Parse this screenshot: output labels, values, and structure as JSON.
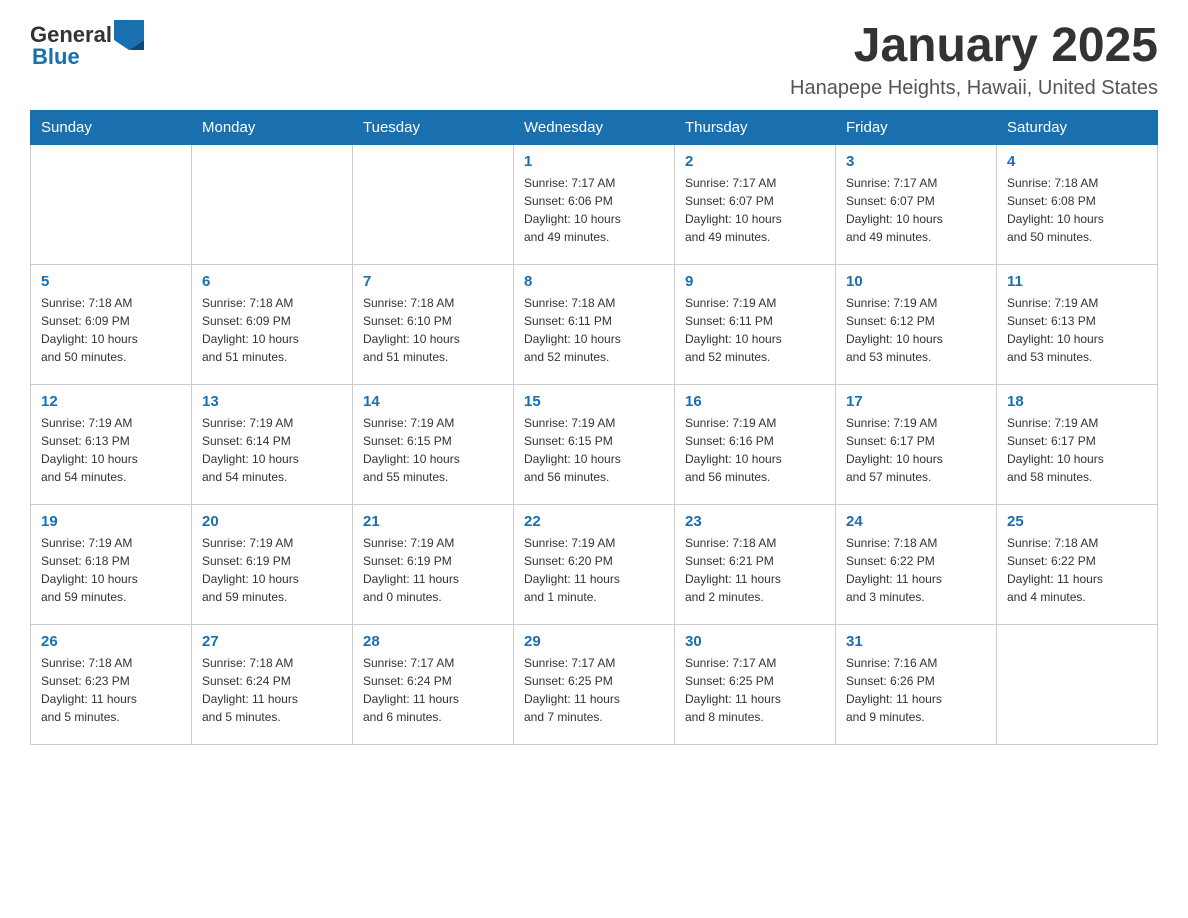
{
  "logo": {
    "general": "General",
    "blue": "Blue"
  },
  "title": "January 2025",
  "subtitle": "Hanapepe Heights, Hawaii, United States",
  "days_of_week": [
    "Sunday",
    "Monday",
    "Tuesday",
    "Wednesday",
    "Thursday",
    "Friday",
    "Saturday"
  ],
  "weeks": [
    [
      {
        "day": "",
        "info": ""
      },
      {
        "day": "",
        "info": ""
      },
      {
        "day": "",
        "info": ""
      },
      {
        "day": "1",
        "info": "Sunrise: 7:17 AM\nSunset: 6:06 PM\nDaylight: 10 hours\nand 49 minutes."
      },
      {
        "day": "2",
        "info": "Sunrise: 7:17 AM\nSunset: 6:07 PM\nDaylight: 10 hours\nand 49 minutes."
      },
      {
        "day": "3",
        "info": "Sunrise: 7:17 AM\nSunset: 6:07 PM\nDaylight: 10 hours\nand 49 minutes."
      },
      {
        "day": "4",
        "info": "Sunrise: 7:18 AM\nSunset: 6:08 PM\nDaylight: 10 hours\nand 50 minutes."
      }
    ],
    [
      {
        "day": "5",
        "info": "Sunrise: 7:18 AM\nSunset: 6:09 PM\nDaylight: 10 hours\nand 50 minutes."
      },
      {
        "day": "6",
        "info": "Sunrise: 7:18 AM\nSunset: 6:09 PM\nDaylight: 10 hours\nand 51 minutes."
      },
      {
        "day": "7",
        "info": "Sunrise: 7:18 AM\nSunset: 6:10 PM\nDaylight: 10 hours\nand 51 minutes."
      },
      {
        "day": "8",
        "info": "Sunrise: 7:18 AM\nSunset: 6:11 PM\nDaylight: 10 hours\nand 52 minutes."
      },
      {
        "day": "9",
        "info": "Sunrise: 7:19 AM\nSunset: 6:11 PM\nDaylight: 10 hours\nand 52 minutes."
      },
      {
        "day": "10",
        "info": "Sunrise: 7:19 AM\nSunset: 6:12 PM\nDaylight: 10 hours\nand 53 minutes."
      },
      {
        "day": "11",
        "info": "Sunrise: 7:19 AM\nSunset: 6:13 PM\nDaylight: 10 hours\nand 53 minutes."
      }
    ],
    [
      {
        "day": "12",
        "info": "Sunrise: 7:19 AM\nSunset: 6:13 PM\nDaylight: 10 hours\nand 54 minutes."
      },
      {
        "day": "13",
        "info": "Sunrise: 7:19 AM\nSunset: 6:14 PM\nDaylight: 10 hours\nand 54 minutes."
      },
      {
        "day": "14",
        "info": "Sunrise: 7:19 AM\nSunset: 6:15 PM\nDaylight: 10 hours\nand 55 minutes."
      },
      {
        "day": "15",
        "info": "Sunrise: 7:19 AM\nSunset: 6:15 PM\nDaylight: 10 hours\nand 56 minutes."
      },
      {
        "day": "16",
        "info": "Sunrise: 7:19 AM\nSunset: 6:16 PM\nDaylight: 10 hours\nand 56 minutes."
      },
      {
        "day": "17",
        "info": "Sunrise: 7:19 AM\nSunset: 6:17 PM\nDaylight: 10 hours\nand 57 minutes."
      },
      {
        "day": "18",
        "info": "Sunrise: 7:19 AM\nSunset: 6:17 PM\nDaylight: 10 hours\nand 58 minutes."
      }
    ],
    [
      {
        "day": "19",
        "info": "Sunrise: 7:19 AM\nSunset: 6:18 PM\nDaylight: 10 hours\nand 59 minutes."
      },
      {
        "day": "20",
        "info": "Sunrise: 7:19 AM\nSunset: 6:19 PM\nDaylight: 10 hours\nand 59 minutes."
      },
      {
        "day": "21",
        "info": "Sunrise: 7:19 AM\nSunset: 6:19 PM\nDaylight: 11 hours\nand 0 minutes."
      },
      {
        "day": "22",
        "info": "Sunrise: 7:19 AM\nSunset: 6:20 PM\nDaylight: 11 hours\nand 1 minute."
      },
      {
        "day": "23",
        "info": "Sunrise: 7:18 AM\nSunset: 6:21 PM\nDaylight: 11 hours\nand 2 minutes."
      },
      {
        "day": "24",
        "info": "Sunrise: 7:18 AM\nSunset: 6:22 PM\nDaylight: 11 hours\nand 3 minutes."
      },
      {
        "day": "25",
        "info": "Sunrise: 7:18 AM\nSunset: 6:22 PM\nDaylight: 11 hours\nand 4 minutes."
      }
    ],
    [
      {
        "day": "26",
        "info": "Sunrise: 7:18 AM\nSunset: 6:23 PM\nDaylight: 11 hours\nand 5 minutes."
      },
      {
        "day": "27",
        "info": "Sunrise: 7:18 AM\nSunset: 6:24 PM\nDaylight: 11 hours\nand 5 minutes."
      },
      {
        "day": "28",
        "info": "Sunrise: 7:17 AM\nSunset: 6:24 PM\nDaylight: 11 hours\nand 6 minutes."
      },
      {
        "day": "29",
        "info": "Sunrise: 7:17 AM\nSunset: 6:25 PM\nDaylight: 11 hours\nand 7 minutes."
      },
      {
        "day": "30",
        "info": "Sunrise: 7:17 AM\nSunset: 6:25 PM\nDaylight: 11 hours\nand 8 minutes."
      },
      {
        "day": "31",
        "info": "Sunrise: 7:16 AM\nSunset: 6:26 PM\nDaylight: 11 hours\nand 9 minutes."
      },
      {
        "day": "",
        "info": ""
      }
    ]
  ]
}
